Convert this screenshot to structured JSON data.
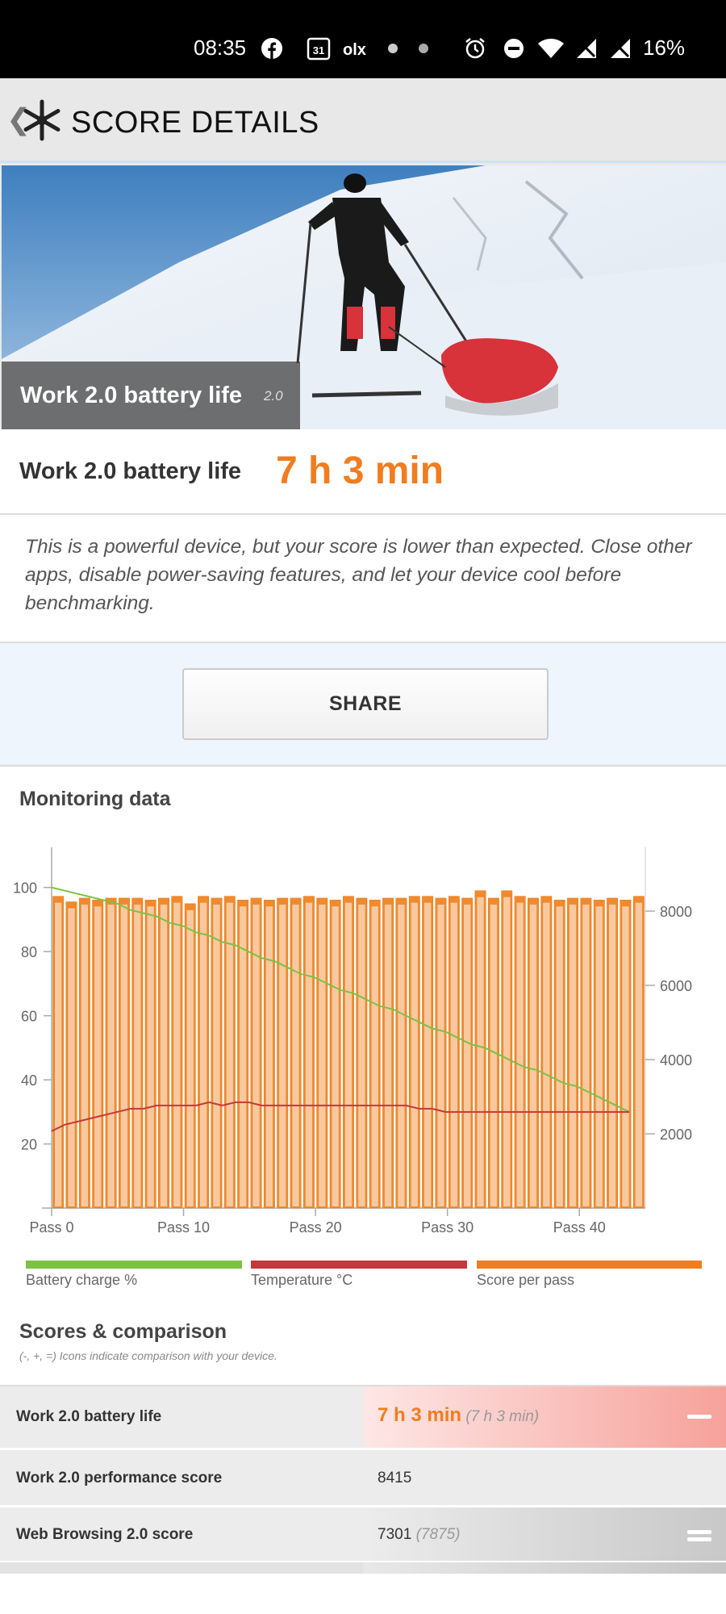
{
  "status_bar": {
    "time": "08:35",
    "battery": "16%",
    "icons": [
      "facebook-icon",
      "calendar-icon",
      "olx-icon",
      "dot-icon",
      "dot-icon",
      "alarm-icon",
      "dnd-icon",
      "wifi-icon",
      "no-signal-icon",
      "no-signal-icon"
    ],
    "calendar_day": "31",
    "olx_label": "olx"
  },
  "header": {
    "title": "SCORE DETAILS"
  },
  "hero": {
    "title": "Work 2.0 battery life",
    "version": "2.0"
  },
  "result": {
    "label": "Work 2.0 battery life",
    "value": "7 h 3 min"
  },
  "note": "This is a powerful device, but your score is lower than expected. Close other apps, disable power-saving features, and let your device cool before benchmarking.",
  "share_label": "SHARE",
  "monitoring_title": "Monitoring data",
  "legend": [
    {
      "label": "Battery charge %",
      "color": "#7cc242"
    },
    {
      "label": "Temperature °C",
      "color": "#c7373b"
    },
    {
      "label": "Score per pass",
      "color": "#f07d20"
    }
  ],
  "chart_data": {
    "type": "bar+line",
    "x_ticks": [
      "Pass 0",
      "Pass 10",
      "Pass 20",
      "Pass 30",
      "Pass 40"
    ],
    "y_left_ticks": [
      "20",
      "40",
      "60",
      "80",
      "100"
    ],
    "y_right_ticks": [
      "2000",
      "4000",
      "6000",
      "8000"
    ],
    "ylim_left": [
      0,
      110
    ],
    "ylim_right": [
      0,
      9500
    ],
    "passes": 45,
    "series": [
      {
        "name": "Score per pass",
        "axis": "right",
        "values": [
          8400,
          8250,
          8350,
          8300,
          8350,
          8350,
          8350,
          8300,
          8350,
          8400,
          8200,
          8400,
          8350,
          8400,
          8300,
          8350,
          8300,
          8350,
          8350,
          8400,
          8350,
          8300,
          8400,
          8350,
          8300,
          8350,
          8350,
          8400,
          8400,
          8350,
          8400,
          8350,
          8550,
          8350,
          8550,
          8400,
          8350,
          8400,
          8300,
          8350,
          8350,
          8300,
          8350,
          8300,
          8400
        ]
      },
      {
        "name": "Battery charge %",
        "axis": "left",
        "values": [
          100,
          99,
          98,
          97,
          96,
          95,
          93,
          92,
          91,
          89,
          88,
          86,
          85,
          83,
          82,
          80,
          78,
          77,
          75,
          73,
          72,
          70,
          68,
          67,
          65,
          63,
          62,
          60,
          58,
          56,
          55,
          53,
          51,
          50,
          48,
          46,
          44,
          43,
          41,
          39,
          38,
          36,
          34,
          32,
          30
        ]
      },
      {
        "name": "Temperature °C",
        "axis": "left",
        "values": [
          24,
          26,
          27,
          28,
          29,
          30,
          31,
          31,
          32,
          32,
          32,
          32,
          33,
          32,
          33,
          33,
          32,
          32,
          32,
          32,
          32,
          32,
          32,
          32,
          32,
          32,
          32,
          32,
          31,
          31,
          30,
          30,
          30,
          30,
          30,
          30,
          30,
          30,
          30,
          30,
          30,
          30,
          30,
          30,
          30
        ]
      }
    ]
  },
  "scores": {
    "title": "Scores & comparison",
    "subtitle": "(-, +, =) Icons indicate comparison with your device.",
    "rows": [
      {
        "name": "Work 2.0 battery life",
        "value": "7 h 3 min",
        "compare": "(7 h 3 min)",
        "icon": "minus"
      },
      {
        "name": "Work 2.0 performance score",
        "value": "8415",
        "compare": "",
        "icon": ""
      },
      {
        "name": "Web Browsing 2.0 score",
        "value": "7301",
        "compare": "(7875)",
        "icon": "equals"
      }
    ]
  }
}
